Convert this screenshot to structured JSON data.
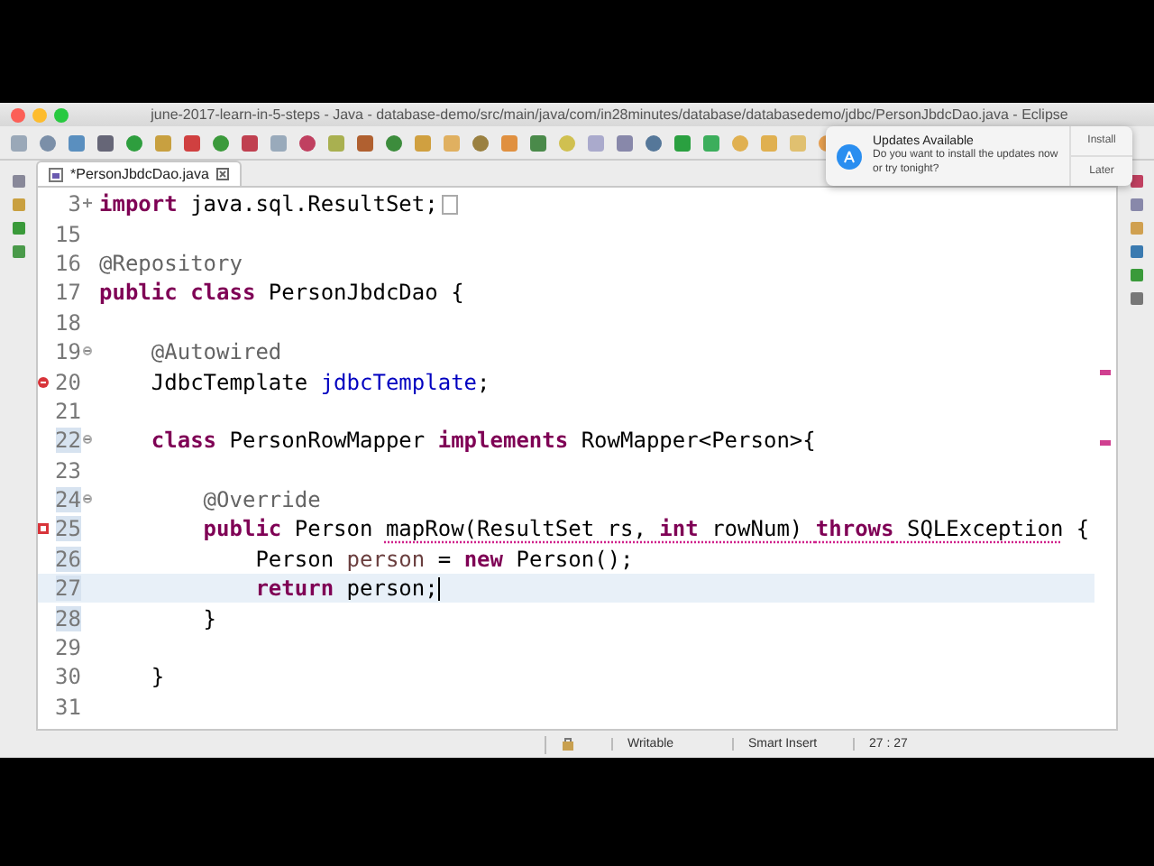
{
  "window": {
    "title": "june-2017-learn-in-5-steps - Java - database-demo/src/main/java/com/in28minutes/database/databasedemo/jdbc/PersonJbdcDao.java - Eclipse"
  },
  "notification": {
    "title": "Updates Available",
    "message": "Do you want to install the updates now or try tonight?",
    "buttons": [
      "Install",
      "Later"
    ]
  },
  "editor_tabs": [
    {
      "label": "*PersonJbdcDao.java",
      "selected": true
    }
  ],
  "code_lines": [
    {
      "number": "3",
      "collapsed": true,
      "error": false,
      "quick_fix": false,
      "range": false,
      "current": false,
      "tokens": [
        {
          "text": "import",
          "kind": "keyword"
        },
        {
          "text": " java.sql.ResultSet;",
          "kind": "plain"
        }
      ]
    },
    {
      "number": "15",
      "error": false,
      "quick_fix": false,
      "range": false,
      "current": false
    },
    {
      "number": "16",
      "error": false,
      "quick_fix": false,
      "range": false,
      "current": false,
      "tokens": [
        {
          "text": "@Repository",
          "kind": "annotation"
        }
      ]
    },
    {
      "number": "17",
      "error": false,
      "quick_fix": false,
      "range": false,
      "current": false,
      "tokens": [
        {
          "text": "public class",
          "kind": "keyword"
        },
        {
          "text": " PersonJbdcDao {",
          "kind": "plain"
        }
      ]
    },
    {
      "number": "18",
      "error": false,
      "quick_fix": false,
      "range": false,
      "current": false
    },
    {
      "number": "19",
      "collapsed": false,
      "error": false,
      "quick_fix": false,
      "range": false,
      "current": false,
      "tokens": [
        {
          "text": "    @Autowired",
          "kind": "annotation"
        }
      ]
    },
    {
      "number": "20",
      "error": true,
      "quick_fix": false,
      "range": false,
      "current": false,
      "tokens": [
        {
          "text": "    JdbcTemplate ",
          "kind": "plain"
        },
        {
          "text": "jdbcTemplate",
          "kind": "field"
        },
        {
          "text": ";",
          "kind": "plain"
        }
      ]
    },
    {
      "number": "21",
      "error": false,
      "quick_fix": false,
      "range": false,
      "current": false
    },
    {
      "number": "22",
      "collapsed": false,
      "error": false,
      "quick_fix": false,
      "range": true,
      "current": false,
      "tokens": [
        {
          "text": "    class",
          "kind": "keyword"
        },
        {
          "text": " PersonRowMapper ",
          "kind": "plain"
        },
        {
          "text": "implements",
          "kind": "keyword"
        },
        {
          "text": " RowMapper<Person>{",
          "kind": "plain"
        }
      ]
    },
    {
      "number": "23",
      "error": false,
      "quick_fix": false,
      "range": false,
      "current": false
    },
    {
      "number": "24",
      "collapsed": false,
      "error": false,
      "quick_fix": false,
      "range": true,
      "current": false,
      "tokens": [
        {
          "text": "        @Override",
          "kind": "annotation"
        }
      ]
    },
    {
      "number": "25",
      "error": false,
      "quick_fix": true,
      "range": true,
      "current": false,
      "tokens": [
        {
          "text": "        public",
          "kind": "keyword"
        },
        {
          "text": " Person ",
          "kind": "plain"
        },
        {
          "text": "mapRow(ResultSet rs, ",
          "kind": "plain",
          "underlined": true
        },
        {
          "text": "int",
          "kind": "keyword",
          "underlined": true
        },
        {
          "text": " rowNum) ",
          "kind": "plain",
          "underlined": true
        },
        {
          "text": "throws",
          "kind": "keyword",
          "underlined": true
        },
        {
          "text": " SQLException",
          "kind": "plain",
          "underlined": true
        },
        {
          "text": " {",
          "kind": "plain"
        }
      ]
    },
    {
      "number": "26",
      "error": false,
      "quick_fix": false,
      "range": true,
      "current": false,
      "tokens": [
        {
          "text": "            Person ",
          "kind": "plain"
        },
        {
          "text": "person",
          "kind": "local"
        },
        {
          "text": " = ",
          "kind": "plain"
        },
        {
          "text": "new",
          "kind": "keyword"
        },
        {
          "text": " Person();",
          "kind": "plain"
        }
      ]
    },
    {
      "number": "27",
      "error": false,
      "quick_fix": false,
      "range": true,
      "current": true,
      "tokens": [
        {
          "text": "            return",
          "kind": "keyword"
        },
        {
          "text": " person;",
          "kind": "plain"
        }
      ]
    },
    {
      "number": "28",
      "error": false,
      "quick_fix": false,
      "range": true,
      "current": false,
      "tokens": [
        {
          "text": "        }",
          "kind": "plain"
        }
      ]
    },
    {
      "number": "29",
      "error": false,
      "quick_fix": false,
      "range": false,
      "current": false
    },
    {
      "number": "30",
      "error": false,
      "quick_fix": false,
      "range": false,
      "current": false,
      "tokens": [
        {
          "text": "    }",
          "kind": "plain"
        }
      ]
    },
    {
      "number": "31",
      "error": false,
      "quick_fix": false,
      "range": false,
      "current": false
    }
  ],
  "status_bar": {
    "mode": "Writable",
    "insert_mode": "Smart Insert",
    "position": "27 : 27"
  }
}
